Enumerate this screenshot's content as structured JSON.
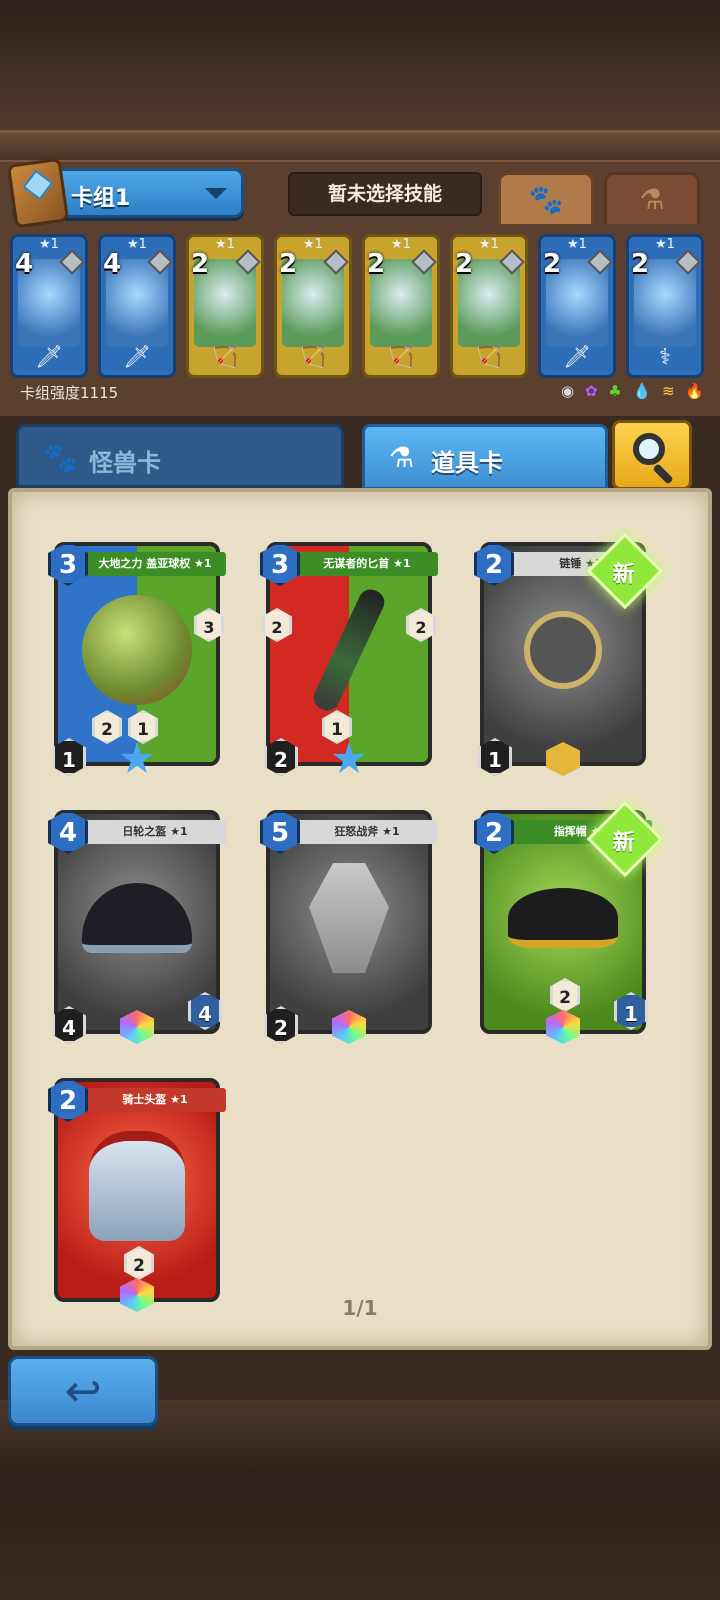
{
  "deck": {
    "name": "卡组1",
    "skill_button": "暂未选择技能",
    "strength_label": "卡组强度1115",
    "element_icons": [
      "neutral-icon",
      "purple-icon",
      "green-icon",
      "water-icon",
      "yellow-icon",
      "fire-icon"
    ],
    "cards": [
      {
        "stars": "★1",
        "cost": "4",
        "theme": "blue",
        "weapon": "sword-icon"
      },
      {
        "stars": "★1",
        "cost": "4",
        "theme": "blue",
        "weapon": "sword-icon"
      },
      {
        "stars": "★1",
        "cost": "2",
        "theme": "gold",
        "weapon": "bow-icon"
      },
      {
        "stars": "★1",
        "cost": "2",
        "theme": "gold",
        "weapon": "bow-icon"
      },
      {
        "stars": "★1",
        "cost": "2",
        "theme": "gold",
        "weapon": "bow-icon"
      },
      {
        "stars": "★1",
        "cost": "2",
        "theme": "gold",
        "weapon": "bow-icon"
      },
      {
        "stars": "★1",
        "cost": "2",
        "theme": "blue",
        "weapon": "sword-icon"
      },
      {
        "stars": "★1",
        "cost": "2",
        "theme": "blue",
        "weapon": "staff-icon"
      }
    ]
  },
  "tabs": {
    "monster": "怪兽卡",
    "item": "道具卡"
  },
  "items": [
    {
      "name": "大地之力 盖亚球权 ★1",
      "cost": "3",
      "bl": "1",
      "mid1": "2",
      "mid2": "1",
      "side": "3"
    },
    {
      "name": "无谋者的匕首 ★1",
      "cost": "3",
      "bl": "2",
      "mid": "1",
      "side": "2",
      "sidel": "2"
    },
    {
      "name": "链锤 ★1",
      "cost": "2",
      "bl": "1",
      "badge": "新"
    },
    {
      "name": "日轮之盔 ★1",
      "cost": "4",
      "bl": "4",
      "br": "4"
    },
    {
      "name": "狂怒战斧 ★1",
      "cost": "5",
      "bl": "2"
    },
    {
      "name": "指挥帽 ★1",
      "cost": "2",
      "mid": "2",
      "br": "1",
      "badge": "新"
    },
    {
      "name": "骑士头盔 ★1",
      "cost": "2",
      "mid": "2"
    }
  ],
  "page_indicator": "1/1"
}
